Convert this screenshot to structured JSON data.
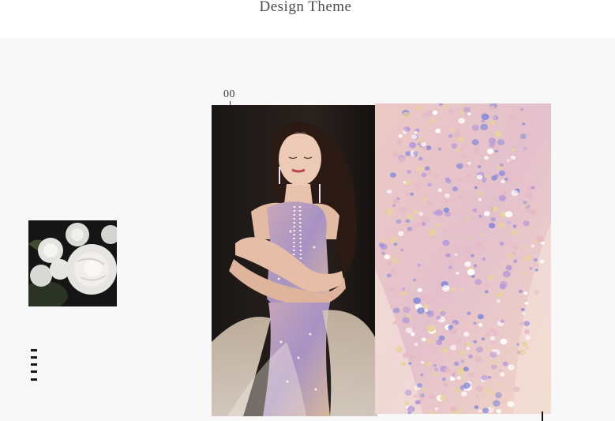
{
  "header": {
    "title": "Design Theme"
  },
  "gallery": {
    "index_label": "00",
    "flower_image_icon": "rose-bouquet-image",
    "model_image_icon": "model-in-sequin-gown-image",
    "fabric_image_icon": "sequin-fabric-closeup-image"
  },
  "colors": {
    "page_background": "#ffffff",
    "content_background": "#f8f8f8",
    "title_text": "#4a4a4a",
    "sequin_pink": "#e6b9c6",
    "sequin_blue": "#8f8fd6",
    "sequin_gold": "#e8d2a0"
  }
}
